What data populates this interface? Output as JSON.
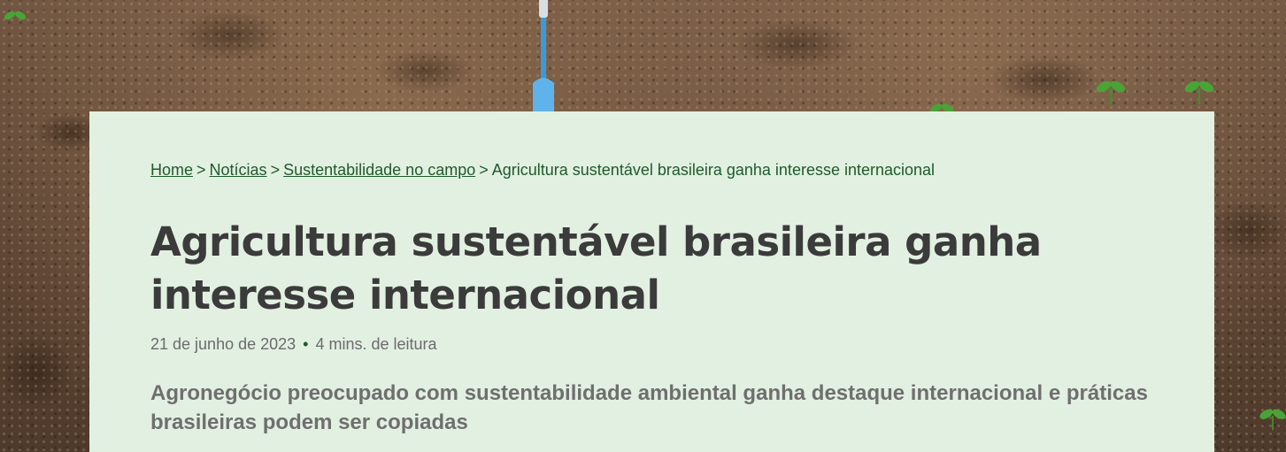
{
  "breadcrumb": {
    "items": [
      {
        "label": "Home"
      },
      {
        "label": "Notícias"
      },
      {
        "label": "Sustentabilidade no campo"
      }
    ],
    "current": "Agricultura sustentável brasileira ganha interesse internacional",
    "separator": ">"
  },
  "article": {
    "title": "Agricultura sustentável brasileira ganha interesse internacional",
    "date": "21 de junho de 2023",
    "meta_separator": "•",
    "reading_time": "4 mins. de leitura",
    "lead": "Agronegócio preocupado com sustentabilidade ambiental ganha destaque internacional e práticas brasileiras podem ser copiadas"
  },
  "colors": {
    "card_background": "#e2f0e1",
    "link_green": "#1f5a2c",
    "title_text": "#3b3b3b",
    "soil_brown": "#5c4433"
  },
  "icons": {
    "garden_tool": "garden-trowel-icon",
    "plant": "sprout-icon"
  }
}
